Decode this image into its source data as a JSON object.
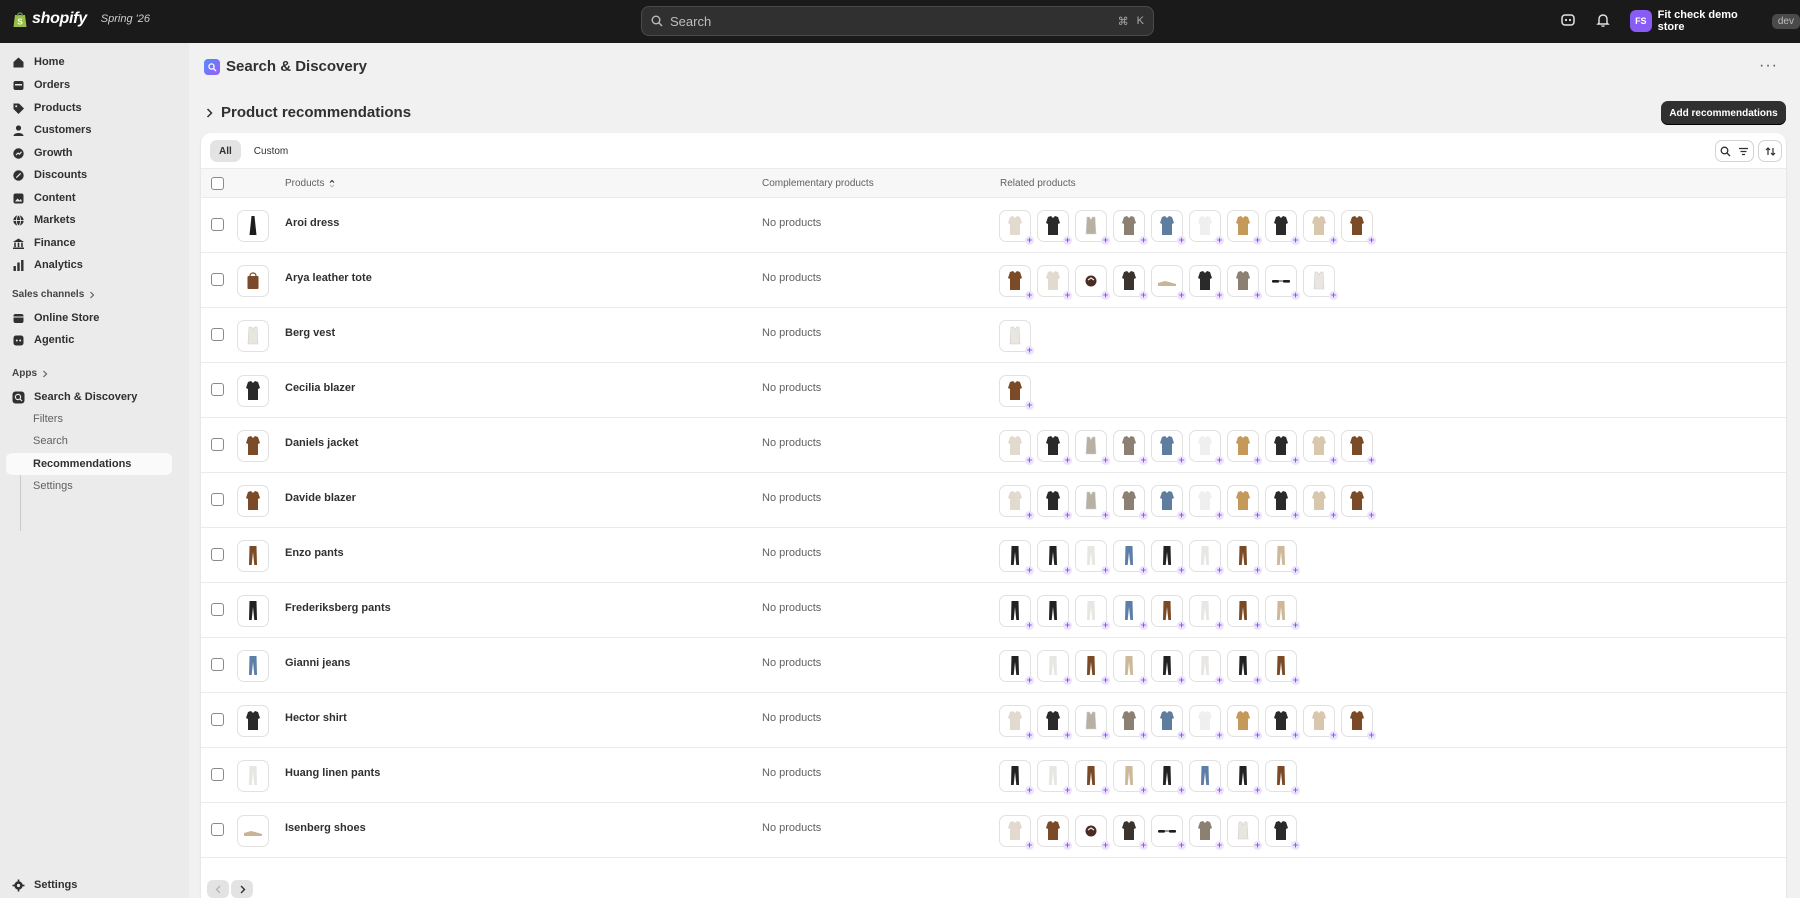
{
  "topbar": {
    "brand": "shopify",
    "edition": "Spring '26",
    "search_placeholder": "Search",
    "shortcut_1": "⌘",
    "shortcut_2": "K",
    "avatar_initials": "FS",
    "store_name": "Fit check demo store",
    "store_badge": "dev"
  },
  "sidebar": {
    "items": [
      {
        "label": "Home",
        "icon": "home-icon"
      },
      {
        "label": "Orders",
        "icon": "orders-icon"
      },
      {
        "label": "Products",
        "icon": "tag-icon"
      },
      {
        "label": "Customers",
        "icon": "person-icon"
      },
      {
        "label": "Growth",
        "icon": "growth-icon"
      },
      {
        "label": "Discounts",
        "icon": "discount-icon"
      },
      {
        "label": "Content",
        "icon": "content-icon"
      },
      {
        "label": "Markets",
        "icon": "globe-icon"
      },
      {
        "label": "Finance",
        "icon": "bank-icon"
      },
      {
        "label": "Analytics",
        "icon": "chart-icon"
      }
    ],
    "sales_channels_title": "Sales channels",
    "channels": [
      {
        "label": "Online Store",
        "icon": "store-icon"
      },
      {
        "label": "Agentic",
        "icon": "agentic-icon"
      }
    ],
    "apps_title": "Apps",
    "app_label": "Search & Discovery",
    "app_subitems": [
      "Filters",
      "Search",
      "Recommendations",
      "Settings"
    ],
    "settings_label": "Settings"
  },
  "main": {
    "title": "Search & Discovery",
    "section_title": "Product recommendations",
    "add_button": "Add recommendations",
    "tabs": [
      "All",
      "Custom"
    ],
    "columns": {
      "products": "Products",
      "complementary": "Complementary products",
      "related": "Related products"
    },
    "rows": [
      {
        "name": "Aroi dress",
        "thumb": "dress",
        "complementary": "No products",
        "related": [
          "coat-light",
          "jacket-black",
          "vest-grey",
          "jacket-tweed",
          "shirt-blue",
          "shirt-white",
          "coat-camel",
          "jacket-black",
          "coat-beige",
          "jacket-brown"
        ]
      },
      {
        "name": "Arya leather tote",
        "thumb": "bag",
        "complementary": "No products",
        "related": [
          "jacket-brown",
          "coat-light",
          "cap",
          "jacket-dark",
          "shoe",
          "jacket-black",
          "jacket-tweed",
          "sunglasses",
          "vest-white"
        ]
      },
      {
        "name": "Berg vest",
        "thumb": "vest-white",
        "complementary": "No products",
        "related": [
          "vest-white"
        ]
      },
      {
        "name": "Cecilia blazer",
        "thumb": "jacket-black",
        "complementary": "No products",
        "related": [
          "jacket-brown"
        ]
      },
      {
        "name": "Daniels jacket",
        "thumb": "jacket-brown",
        "complementary": "No products",
        "related": [
          "coat-light",
          "jacket-black",
          "vest-grey",
          "jacket-tweed",
          "shirt-blue",
          "shirt-white",
          "coat-camel",
          "jacket-black",
          "coat-beige",
          "jacket-brown"
        ]
      },
      {
        "name": "Davide blazer",
        "thumb": "jacket-brown",
        "complementary": "No products",
        "related": [
          "coat-light",
          "jacket-black",
          "vest-grey",
          "jacket-tweed",
          "shirt-blue",
          "shirt-white",
          "coat-camel",
          "jacket-black",
          "coat-beige",
          "jacket-brown"
        ]
      },
      {
        "name": "Enzo pants",
        "thumb": "pants-brown",
        "complementary": "No products",
        "related": [
          "pants-black",
          "pants-black",
          "pants-white",
          "pants-blue",
          "pants-black",
          "pants-white",
          "pants-brown",
          "pants-beige"
        ]
      },
      {
        "name": "Frederiksberg pants",
        "thumb": "pants-black",
        "complementary": "No products",
        "related": [
          "pants-black",
          "pants-black",
          "pants-white",
          "pants-blue",
          "pants-brown",
          "pants-white",
          "pants-brown",
          "pants-beige"
        ]
      },
      {
        "name": "Gianni jeans",
        "thumb": "pants-blue",
        "complementary": "No products",
        "related": [
          "pants-black",
          "pants-white",
          "pants-brown",
          "pants-beige",
          "pants-black",
          "pants-white",
          "pants-black",
          "pants-brown"
        ]
      },
      {
        "name": "Hector shirt",
        "thumb": "jacket-black",
        "complementary": "No products",
        "related": [
          "coat-light",
          "jacket-black",
          "vest-grey",
          "jacket-tweed",
          "shirt-blue",
          "shirt-white",
          "coat-camel",
          "jacket-black",
          "coat-beige",
          "jacket-brown"
        ]
      },
      {
        "name": "Huang linen pants",
        "thumb": "pants-white",
        "complementary": "No products",
        "related": [
          "pants-black",
          "pants-white",
          "pants-brown",
          "pants-beige",
          "pants-black",
          "pants-blue",
          "pants-black",
          "pants-brown"
        ]
      },
      {
        "name": "Isenberg shoes",
        "thumb": "shoe",
        "complementary": "No products",
        "related": [
          "coat-light",
          "jacket-brown",
          "cap",
          "jacket-dark",
          "sunglasses",
          "jacket-tweed",
          "vest-white",
          "jacket-black"
        ]
      }
    ]
  },
  "colors": {
    "topbar": "#1a1a1a",
    "accent": "#8a5cf6",
    "primary_button": "#303030"
  }
}
